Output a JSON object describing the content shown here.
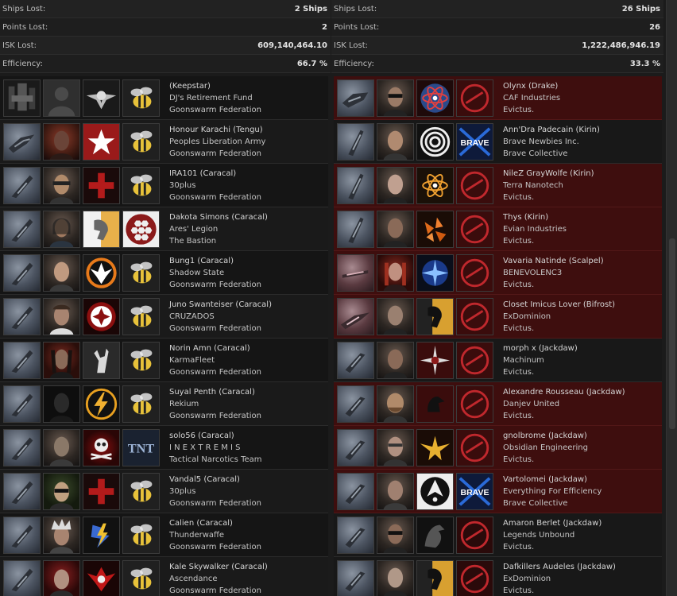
{
  "summary": {
    "left": {
      "ships_lost_label": "Ships Lost:",
      "ships_lost": "2 Ships",
      "points_lost_label": "Points Lost:",
      "points_lost": "2",
      "isk_lost_label": "ISK Lost:",
      "isk_lost": "609,140,464.10",
      "efficiency_label": "Efficiency:",
      "efficiency": "66.7 %"
    },
    "right": {
      "ships_lost_label": "Ships Lost:",
      "ships_lost": "26 Ships",
      "points_lost_label": "Points Lost:",
      "points_lost": "26",
      "isk_lost_label": "ISK Lost:",
      "isk_lost": "1,222,486,946.19",
      "efficiency_label": "Efficiency:",
      "efficiency": "33.3 %"
    }
  },
  "left_pilots": [
    {
      "name": "(Keepstar)",
      "corp": "DJ's Retirement Fund",
      "alliance": "Goonswarm Federation"
    },
    {
      "name": "Honour Karachi (Tengu)",
      "corp": "Peoples Liberation Army",
      "alliance": "Goonswarm Federation"
    },
    {
      "name": "IRA101 (Caracal)",
      "corp": "30plus",
      "alliance": "Goonswarm Federation"
    },
    {
      "name": "Dakota Simons (Caracal)",
      "corp": "Ares' Legion",
      "alliance": "The Bastion"
    },
    {
      "name": "Bung1 (Caracal)",
      "corp": "Shadow State",
      "alliance": "Goonswarm Federation"
    },
    {
      "name": "Juno Swanteiser (Caracal)",
      "corp": "CRUZADOS",
      "alliance": "Goonswarm Federation"
    },
    {
      "name": "Norin Amn (Caracal)",
      "corp": "KarmaFleet",
      "alliance": "Goonswarm Federation"
    },
    {
      "name": "Suyal Penth (Caracal)",
      "corp": "Rekium",
      "alliance": "Goonswarm Federation"
    },
    {
      "name": "solo56 (Caracal)",
      "corp": "I N E X T R E M I S",
      "alliance": "Tactical Narcotics Team"
    },
    {
      "name": "Vandal5 (Caracal)",
      "corp": "30plus",
      "alliance": "Goonswarm Federation"
    },
    {
      "name": "Calien (Caracal)",
      "corp": "Thunderwaffe",
      "alliance": "Goonswarm Federation"
    },
    {
      "name": "Kale Skywalker (Caracal)",
      "corp": "Ascendance",
      "alliance": "Goonswarm Federation"
    }
  ],
  "right_pilots": [
    {
      "name": "Olynx (Drake)",
      "corp": "CAF Industries",
      "alliance": "Evictus."
    },
    {
      "name": "Ann'Dra Padecain (Kirin)",
      "corp": "Brave Newbies Inc.",
      "alliance": "Brave Collective"
    },
    {
      "name": "NileZ GrayWolfe (Kirin)",
      "corp": "Terra Nanotech",
      "alliance": "Evictus."
    },
    {
      "name": "Thys (Kirin)",
      "corp": "Evian Industries",
      "alliance": "Evictus."
    },
    {
      "name": "Vavaria Natinde (Scalpel)",
      "corp": "BENEVOLENC3",
      "alliance": "Evictus."
    },
    {
      "name": "Closet Imicus Lover (Bifrost)",
      "corp": "ExDominion",
      "alliance": "Evictus."
    },
    {
      "name": "morph x (Jackdaw)",
      "corp": "Machinum",
      "alliance": "Evictus."
    },
    {
      "name": "Alexandre Rousseau (Jackdaw)",
      "corp": "Danjev United",
      "alliance": "Evictus."
    },
    {
      "name": "gnolbrome (Jackdaw)",
      "corp": "Obsidian Engineering",
      "alliance": "Evictus."
    },
    {
      "name": "Vartolomei (Jackdaw)",
      "corp": "Everything For Efficiency",
      "alliance": "Brave Collective"
    },
    {
      "name": "Amaron Berlet (Jackdaw)",
      "corp": "Legends Unbound",
      "alliance": "Evictus."
    },
    {
      "name": "Dafkillers Audeles (Jackdaw)",
      "corp": "ExDominion",
      "alliance": "Evictus."
    }
  ],
  "alliance_logo_text": {
    "brave": "BRAVE",
    "tnt": "TNT"
  },
  "colors": {
    "highlight_red": "#3e0e0e",
    "goon_yellow": "#e8c23a",
    "evictus_red": "#c0282d"
  }
}
